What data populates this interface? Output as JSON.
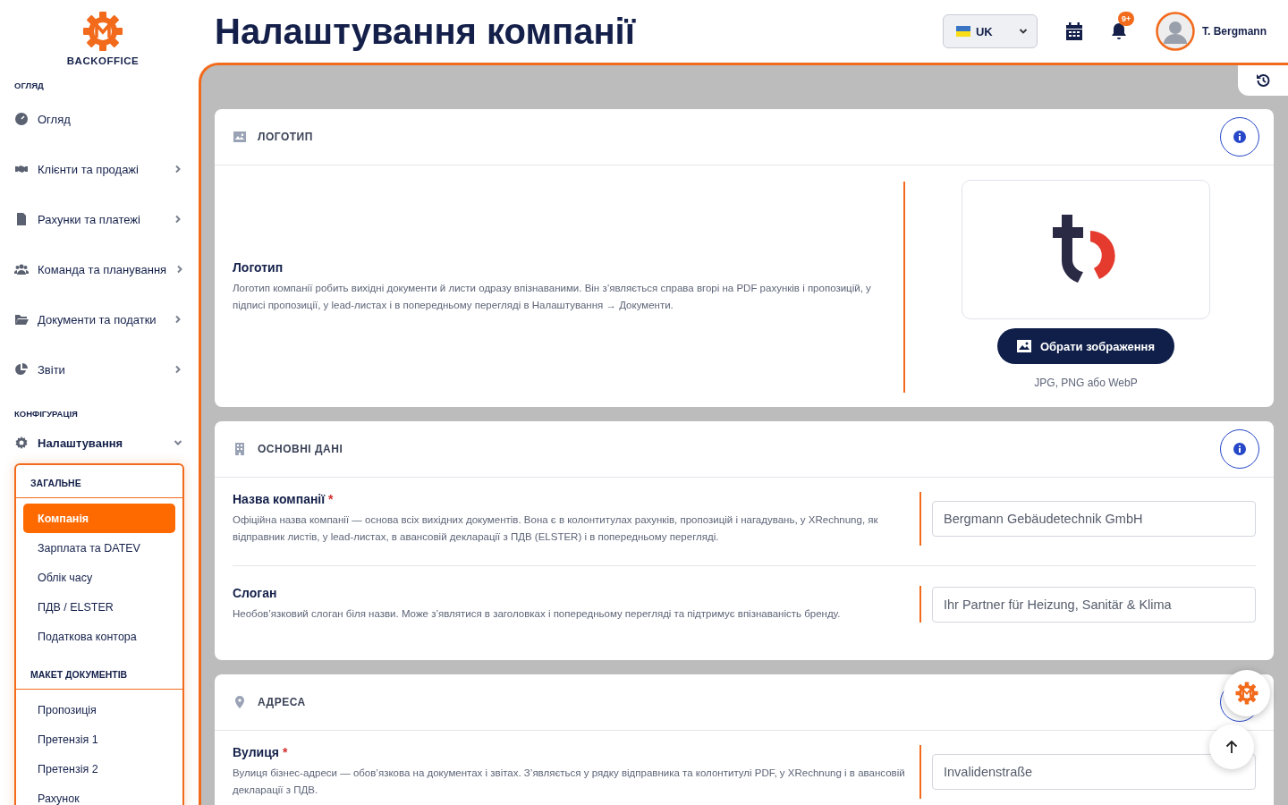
{
  "brand": {
    "name": "BACKOFFICE"
  },
  "sidebar": {
    "sections": [
      {
        "title": "ОГЛЯД",
        "items": [
          {
            "label": "Огляд"
          },
          {
            "label": "Клієнти та продажі",
            "expanded": false
          },
          {
            "label": "Рахунки та платежі",
            "expanded": false
          },
          {
            "label": "Команда та планування",
            "expanded": false
          },
          {
            "label": "Документи та податки",
            "expanded": false
          },
          {
            "label": "Звіти",
            "expanded": false
          }
        ]
      },
      {
        "title": "КОНФІГУРАЦІЯ",
        "items": [
          {
            "label": "Налаштування",
            "expanded": true,
            "submenu": [
              {
                "title": "ЗАГАЛЬНЕ",
                "items": [
                  {
                    "label": "Компанія",
                    "selected": true
                  },
                  {
                    "label": "Зарплата та DATEV",
                    "selected": false
                  },
                  {
                    "label": "Облік часу",
                    "selected": false
                  },
                  {
                    "label": "ПДВ / ELSTER",
                    "selected": false
                  },
                  {
                    "label": "Податкова контора",
                    "selected": false
                  }
                ]
              },
              {
                "title": "МАКЕТ ДОКУМЕНТІВ",
                "items": [
                  {
                    "label": "Пропозиція",
                    "selected": false
                  },
                  {
                    "label": "Претензія 1",
                    "selected": false
                  },
                  {
                    "label": "Претензія 2",
                    "selected": false
                  },
                  {
                    "label": "Рахунок",
                    "selected": false
                  }
                ]
              }
            ]
          }
        ]
      }
    ]
  },
  "header": {
    "title": "Налаштування компанії",
    "language": "UK",
    "notifications_badge": "9+",
    "user_name": "T. Bergmann"
  },
  "cards": [
    {
      "title": "ЛОГОТИП",
      "kind": "logo",
      "fields": [
        {
          "label": "Логотип",
          "description": "Логотип компанії робить вихідні документи й листи одразу впізнаваними. Він з’являється справа вгорі на PDF рахунків і пропозицій, у підписі пропозиції, у lead-листах і в попередньому перегляді в Налаштування → Документи.",
          "button": "Обрати зображення",
          "hint": "JPG, PNG або WebP"
        }
      ]
    },
    {
      "title": "ОСНОВНІ ДАНІ",
      "kind": "form",
      "fields": [
        {
          "label": "Назва компанії",
          "required_mark": "*",
          "description": "Офіційна назва компанії — основа всіх вихідних документів. Вона є в колонтитулах рахунків, пропозицій і нагадувань, у XRechnung, як відправник листів, у lead-листах, в авансовій декларації з ПДВ (ELSTER) і в попередньому перегляді.",
          "value": "Bergmann Gebäudetechnik GmbH"
        },
        {
          "label": "Слоган",
          "description": "Необов’язковий слоган біля назви. Може з’являтися в заголовках і попередньому перегляді та підтримує впізнаваність бренду.",
          "value": "Ihr Partner für Heizung, Sanitär & Klima"
        }
      ]
    },
    {
      "title": "АДРЕСА",
      "kind": "form",
      "fields": [
        {
          "label": "Вулиця",
          "required_mark": "*",
          "description": "Вулиця бізнес-адреси — обов’язкова на документах і звітах. З’являється у рядку відправника та колонтитулі PDF, у XRechnung і в авансовій декларації з ПДВ.",
          "value": "Invalidenstraße"
        }
      ]
    }
  ]
}
